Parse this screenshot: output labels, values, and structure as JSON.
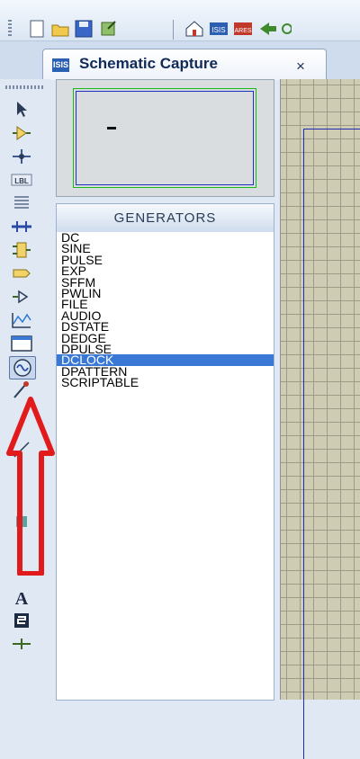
{
  "tab": {
    "badge": "ISIS",
    "title": "Schematic Capture",
    "close": "×"
  },
  "toolbar": {
    "icons": [
      "new-file-icon",
      "open-folder-icon",
      "save-icon",
      "import-icon",
      "home-icon",
      "isis-icon",
      "ares-icon",
      "back-icon"
    ]
  },
  "tools": {
    "items": [
      {
        "name": "selection-mode-tool",
        "icon": "arrow-pointer-icon"
      },
      {
        "name": "component-mode-tool",
        "icon": "component-icon"
      },
      {
        "name": "junction-dot-tool",
        "icon": "junction-icon"
      },
      {
        "name": "wire-label-tool",
        "icon": "label-icon",
        "text": "LBL"
      },
      {
        "name": "text-script-tool",
        "icon": "text-script-icon"
      },
      {
        "name": "buses-tool",
        "icon": "bus-icon"
      },
      {
        "name": "subcircuit-tool",
        "icon": "subcircuit-icon"
      },
      {
        "name": "terminals-tool",
        "icon": "terminal-icon"
      },
      {
        "name": "device-pins-tool",
        "icon": "pin-icon"
      },
      {
        "name": "graph-mode-tool",
        "icon": "graph-icon"
      },
      {
        "name": "tape-recorder-tool",
        "icon": "tape-icon"
      },
      {
        "name": "generator-mode-tool",
        "icon": "generator-icon"
      },
      {
        "name": "voltage-probe-tool",
        "icon": "probe-icon"
      },
      {
        "name": "text-tool",
        "icon": "text-a-icon",
        "text": "A"
      },
      {
        "name": "symbol-tool",
        "icon": "symbol-icon"
      },
      {
        "name": "marker-tool",
        "icon": "marker-icon"
      }
    ]
  },
  "generators": {
    "header": "GENERATORS",
    "items": [
      "DC",
      "SINE",
      "PULSE",
      "EXP",
      "SFFM",
      "PWLIN",
      "FILE",
      "AUDIO",
      "DSTATE",
      "DEDGE",
      "DPULSE",
      "DCLOCK",
      "DPATTERN",
      "SCRIPTABLE"
    ],
    "selected": "DCLOCK"
  },
  "colors": {
    "accent": "#3a78d6",
    "grid_bg": "#cfccb4",
    "sheet_border": "#1f2ab8",
    "annotation": "#e11b1b"
  }
}
